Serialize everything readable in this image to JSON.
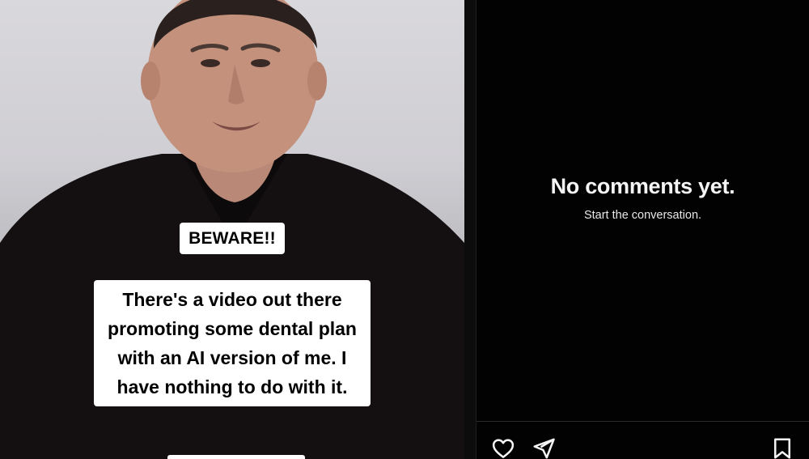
{
  "post": {
    "caption_beware": "BEWARE!!",
    "caption_main": "There's a video out there promoting some dental plan with an AI version of me.  I have nothing to do with it."
  },
  "comments_panel": {
    "empty_title": "No comments yet.",
    "empty_subtitle": "Start the conversation."
  },
  "actions": {
    "like_icon": "heart-icon",
    "share_icon": "paper-plane-icon",
    "save_icon": "bookmark-icon"
  },
  "colors": {
    "panel_background": "#020202",
    "caption_background": "#ffffff",
    "text_primary": "#f5f5f5"
  }
}
